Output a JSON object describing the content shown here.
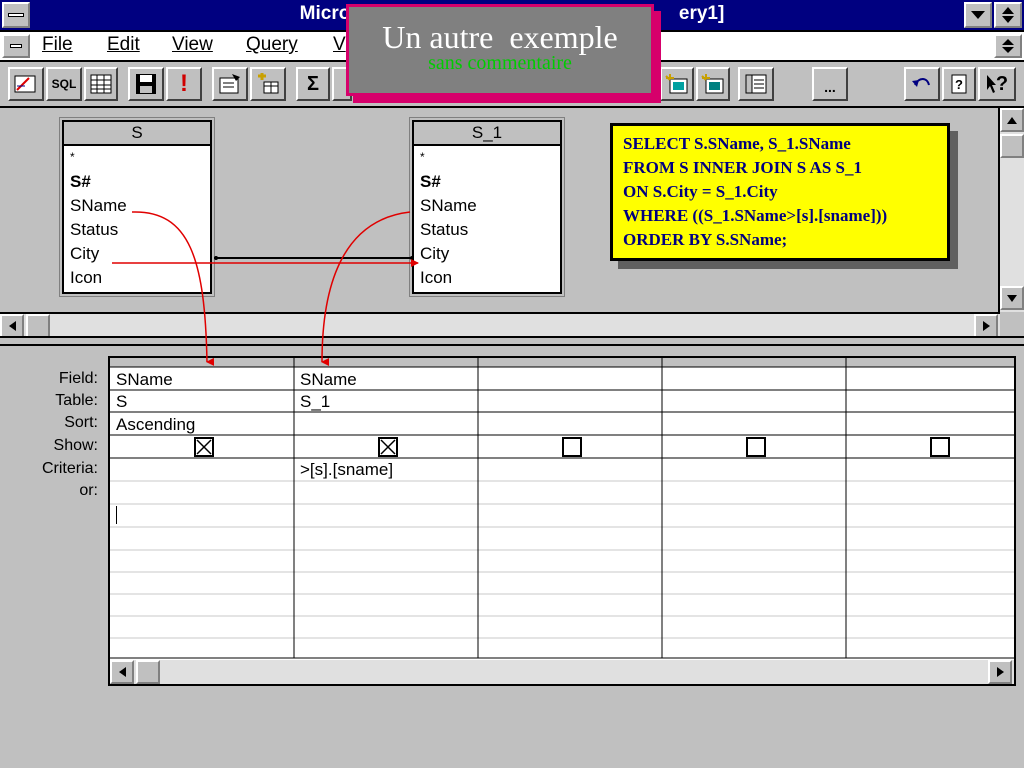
{
  "window": {
    "title_left": "Micros",
    "title_right": "ery1]"
  },
  "menu": {
    "file": "File",
    "edit": "Edit",
    "view": "View",
    "query": "Query",
    "window_partial": "V"
  },
  "toolbar": {
    "sql_label": "SQL",
    "sigma_label": "Σ",
    "exclaim_label": "!",
    "ellipsis_label": "...",
    "help_label": "?"
  },
  "tables": [
    {
      "name": "S",
      "fields": [
        "*",
        "S#",
        "SName",
        "Status",
        "City",
        "Icon"
      ]
    },
    {
      "name": "S_1",
      "fields": [
        "*",
        "S#",
        "SName",
        "Status",
        "City",
        "Icon"
      ]
    }
  ],
  "grid": {
    "row_labels": [
      "Field:",
      "Table:",
      "Sort:",
      "Show:",
      "Criteria:",
      "or:"
    ],
    "columns": [
      {
        "field": "SName",
        "table": "S",
        "sort": "Ascending",
        "show": true,
        "criteria": ""
      },
      {
        "field": "SName",
        "table": "S_1",
        "sort": "",
        "show": true,
        "criteria": ">[s].[sname]"
      },
      {
        "field": "",
        "table": "",
        "sort": "",
        "show": false,
        "criteria": ""
      },
      {
        "field": "",
        "table": "",
        "sort": "",
        "show": false,
        "criteria": ""
      },
      {
        "field": "",
        "table": "",
        "sort": "",
        "show": false,
        "criteria": ""
      }
    ]
  },
  "sql": {
    "lines": [
      "SELECT  S.SName, S_1.SName",
      "FROM S INNER JOIN S AS S_1",
      "ON S.City = S_1.City",
      "WHERE ((S_1.SName>[s].[sname]))",
      "ORDER BY S.SName;"
    ]
  },
  "overlay": {
    "title": "Un autre  exemple",
    "subtitle": "sans commentaire"
  },
  "colors": {
    "titlebar": "#000080",
    "sql_bg": "#ffff00",
    "sql_text": "#000080",
    "overlay_border": "#d6006b",
    "overlay_subtitle": "#00cc00",
    "join_line": "#e00000"
  }
}
